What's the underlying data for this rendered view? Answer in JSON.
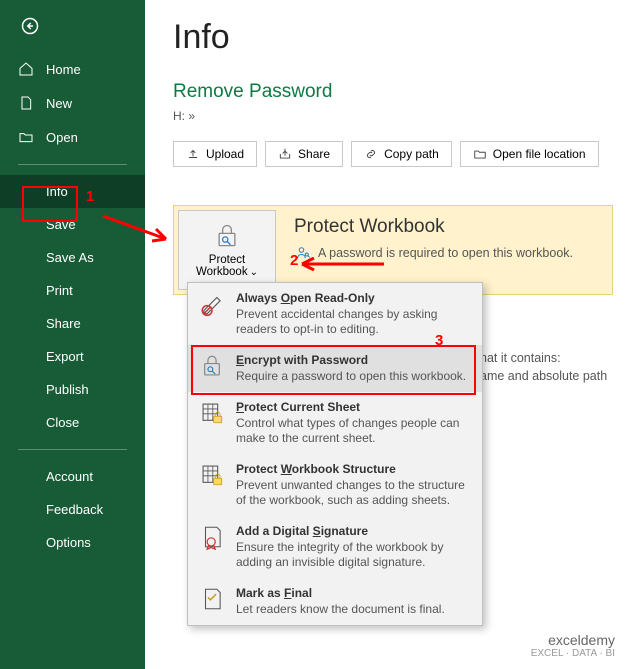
{
  "sidebar": {
    "items": [
      {
        "label": "Home"
      },
      {
        "label": "New"
      },
      {
        "label": "Open"
      },
      {
        "label": "Info"
      },
      {
        "label": "Save"
      },
      {
        "label": "Save As"
      },
      {
        "label": "Print"
      },
      {
        "label": "Share"
      },
      {
        "label": "Export"
      },
      {
        "label": "Publish"
      },
      {
        "label": "Close"
      },
      {
        "label": "Account"
      },
      {
        "label": "Feedback"
      },
      {
        "label": "Options"
      }
    ]
  },
  "main": {
    "title": "Info",
    "subtitle": "Remove Password",
    "path": "H: »",
    "buttons": {
      "upload": "Upload",
      "share": "Share",
      "copy": "Copy path",
      "open_loc": "Open file location"
    },
    "protect": {
      "btn_label": "Protect Workbook",
      "heading": "Protect Workbook",
      "desc": "A password is required to open this workbook."
    },
    "behind1": "hat it contains:",
    "behind2": "ame and absolute path"
  },
  "menu": {
    "items": [
      {
        "t": "Always Open Read-Only",
        "u": "O",
        "d": "Prevent accidental changes by asking readers to opt-in to editing."
      },
      {
        "t": "Encrypt with Password",
        "u": "E",
        "d": "Require a password to open this workbook."
      },
      {
        "t": "Protect Current Sheet",
        "u": "P",
        "d": "Control what types of changes people can make to the current sheet."
      },
      {
        "t": "Protect Workbook Structure",
        "u": "W",
        "d": "Prevent unwanted changes to the structure of the workbook, such as adding sheets."
      },
      {
        "t": "Add a Digital Signature",
        "u": "S",
        "d": "Ensure the integrity of the workbook by adding an invisible digital signature."
      },
      {
        "t": "Mark as Final",
        "u": "F",
        "d": "Let readers know the document is final."
      }
    ]
  },
  "anno": {
    "a1": "1",
    "a2": "2",
    "a3": "3"
  },
  "watermark": {
    "brand": "exceldemy",
    "tag": "EXCEL · DATA · BI"
  }
}
